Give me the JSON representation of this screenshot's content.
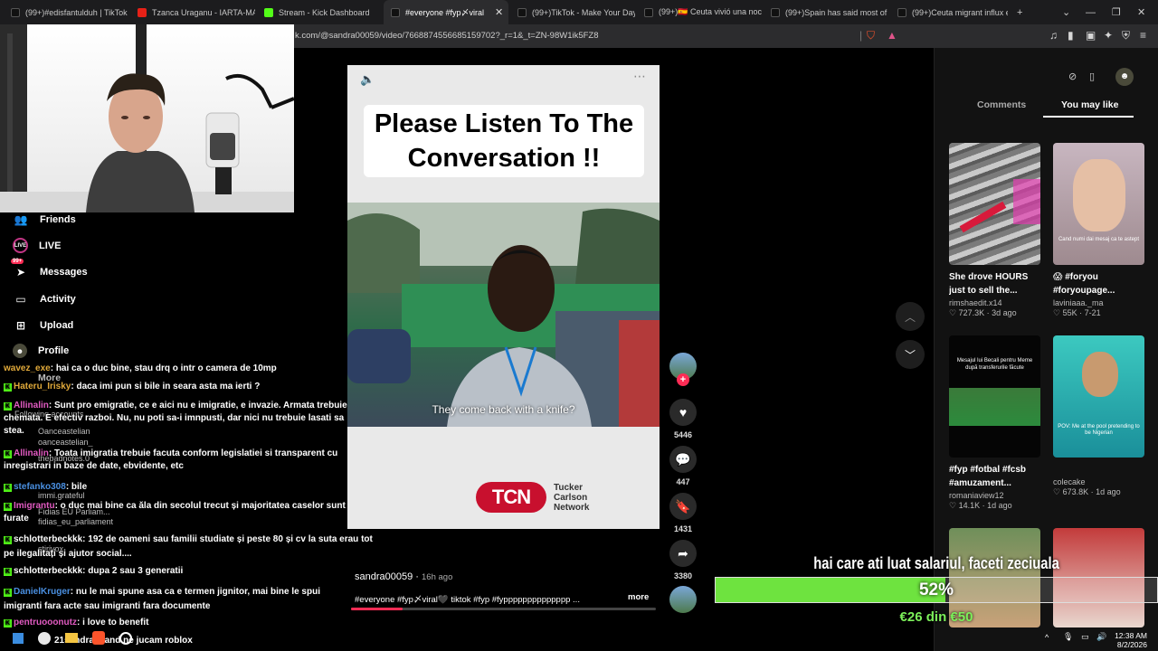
{
  "browser": {
    "tabs": [
      {
        "label": "(99+)#edisfantulduh | TikTok",
        "favicon": "tiktok-icon",
        "active": false
      },
      {
        "label": "Tzanca Uraganu - IARTA-MA M",
        "favicon": "youtube-icon",
        "active": false
      },
      {
        "label": "Stream - Kick Dashboard",
        "favicon": "kick-icon",
        "active": false
      },
      {
        "label": "#everyone #fyp〆viral",
        "favicon": "tiktok-icon",
        "active": true
      },
      {
        "label": "(99+)TikTok - Make Your Day",
        "favicon": "tiktok-icon",
        "active": false
      },
      {
        "label": "(99+)🇪🇸 Ceuta vivió una noch",
        "favicon": "tiktok-icon",
        "active": false
      },
      {
        "label": "(99+)Spain has said most of th",
        "favicon": "tiktok-icon",
        "active": false
      },
      {
        "label": "(99+)Ceuta migrant influx ea",
        "favicon": "tiktok-icon",
        "active": false
      }
    ],
    "new_tab": "+",
    "url": "k.com/@sandra00059/video/7668874556685159702?_r=1&_t=ZN-98W1ik5FZ8"
  },
  "sidebar": {
    "items": [
      {
        "label": "Friends",
        "icon": "friends-icon"
      },
      {
        "label": "LIVE",
        "icon": "live-icon"
      },
      {
        "label": "Messages",
        "icon": "messages-icon",
        "badge": "99+"
      },
      {
        "label": "Activity",
        "icon": "activity-icon"
      },
      {
        "label": "Upload",
        "icon": "upload-icon"
      },
      {
        "label": "Profile",
        "icon": "profile-icon"
      }
    ],
    "more": "More",
    "following_header": "Following accounts",
    "following": [
      {
        "name": "Oanceastelian",
        "handle": "oanceastelian_"
      },
      {
        "name": "thebadnotes.0",
        "handle": ""
      },
      {
        "name": "immi.grateful",
        "handle": "immi.grateful"
      },
      {
        "name": "Fidias EU Parliam...",
        "handle": "fidias_eu_parliament"
      },
      {
        "name": "stirivox",
        "handle": "stirivox"
      }
    ]
  },
  "chat": [
    {
      "user": "wavez_exe",
      "message": ": hai ca o duc bine, stau drq o intr o camera de 10mp",
      "color": "orange"
    },
    {
      "user": "Hateru_Irisky",
      "message": ": daca imi pun si bile in seara asta ma ierti ?",
      "color": "orange"
    },
    {
      "user": "Allinalin",
      "message": ": Sunt pro emigratie, ce e aici nu e imigratie, e invazie. Armata trebuie chemata. E efectiv razboi. Nu, nu poti sa-i imnpusti, dar nici nu trebuie lasati sa stea.",
      "color": "pink"
    },
    {
      "user": "Allinalin",
      "message": ": Toata imigratia trebuie facuta conform legislatiei si transparent cu inregistrari in baze de date, ebvidente, etc",
      "color": "pink"
    },
    {
      "user": "stefanko308",
      "message": ": bile",
      "color": "blue"
    },
    {
      "user": "Imigrantu",
      "message": ": o duc mai bine ca ăla din secolul trecut și majoritatea caselor sunt furate",
      "color": "pink"
    },
    {
      "user": "schlotterbeckkk",
      "message": ": 192 de oameni sau familii studiate și peste 80 și cv la suta erau tot pe ilegalitați și ajutor social....",
      "color": "white"
    },
    {
      "user": "schlotterbeckkk",
      "message": ": dupa 2 sau 3 generatii",
      "color": "white"
    },
    {
      "user": "DanielKruger",
      "message": ": nu le mai spune asa ca e termen jignitor, mai bine le spui imigranti fara acte sau imigranti fara documente",
      "color": "blue"
    },
    {
      "user": "pentruooonutz",
      "message": ": i love to benefit",
      "color": "pink"
    },
    {
      "user": "21sandra",
      "message": ": cand ne jucam roblox",
      "color": "white"
    }
  ],
  "video": {
    "title": "Please Listen To The Conversation  !!",
    "subtitle": "They come back with a knife?",
    "brand_logo": "TCN",
    "brand_words": [
      "Tucker",
      "Carlson",
      "Network"
    ],
    "author": "sandra00059",
    "ago": "16h ago",
    "description": "#everyone #fyp〆viral🖤 tiktok #fyp #fypppppppppppppp ...",
    "more": "more",
    "progress": 0.17
  },
  "actions": {
    "likes": "5446",
    "comments": "447",
    "saves": "1431",
    "shares": "3380"
  },
  "right_panel": {
    "tabs": [
      "Comments",
      "You may like"
    ],
    "active_tab": "You may like",
    "cards": [
      {
        "title": "She drove HOURS just to sell the...",
        "author": "rimshaedit.x14",
        "likes": "727.3K",
        "date": "3d ago"
      },
      {
        "title": "😱 #foryou #foryoupage...",
        "author": "laviniaaa._ma",
        "likes": "55K",
        "date": "7-21",
        "thumb_text": "Cand numi dai mesaj ca te astept"
      },
      {
        "title": "#fyp #fotbal #fcsb #amuzament...",
        "author": "romaniaview12",
        "likes": "14.1K",
        "date": "1d ago",
        "thumb_text": "Mesajul lui Becali pentru Meme după transferurile făcute"
      },
      {
        "title": "",
        "author": "colecake",
        "likes": "673.8K",
        "date": "1d ago",
        "thumb_text": "POV: Me at the pool pretending to be Nigerian"
      }
    ]
  },
  "donation": {
    "message": "hai care ati luat salariul, faceti zeciuala",
    "percent": "52%",
    "percent_value": 0.52,
    "amount": "€26 din €50"
  },
  "taskbar": {
    "time": "12:38 AM",
    "date": "8/2/2026"
  },
  "colors": {
    "tiktok_red": "#fe2c55",
    "kick_green": "#53fc18",
    "donation_green": "#6ee33f"
  }
}
